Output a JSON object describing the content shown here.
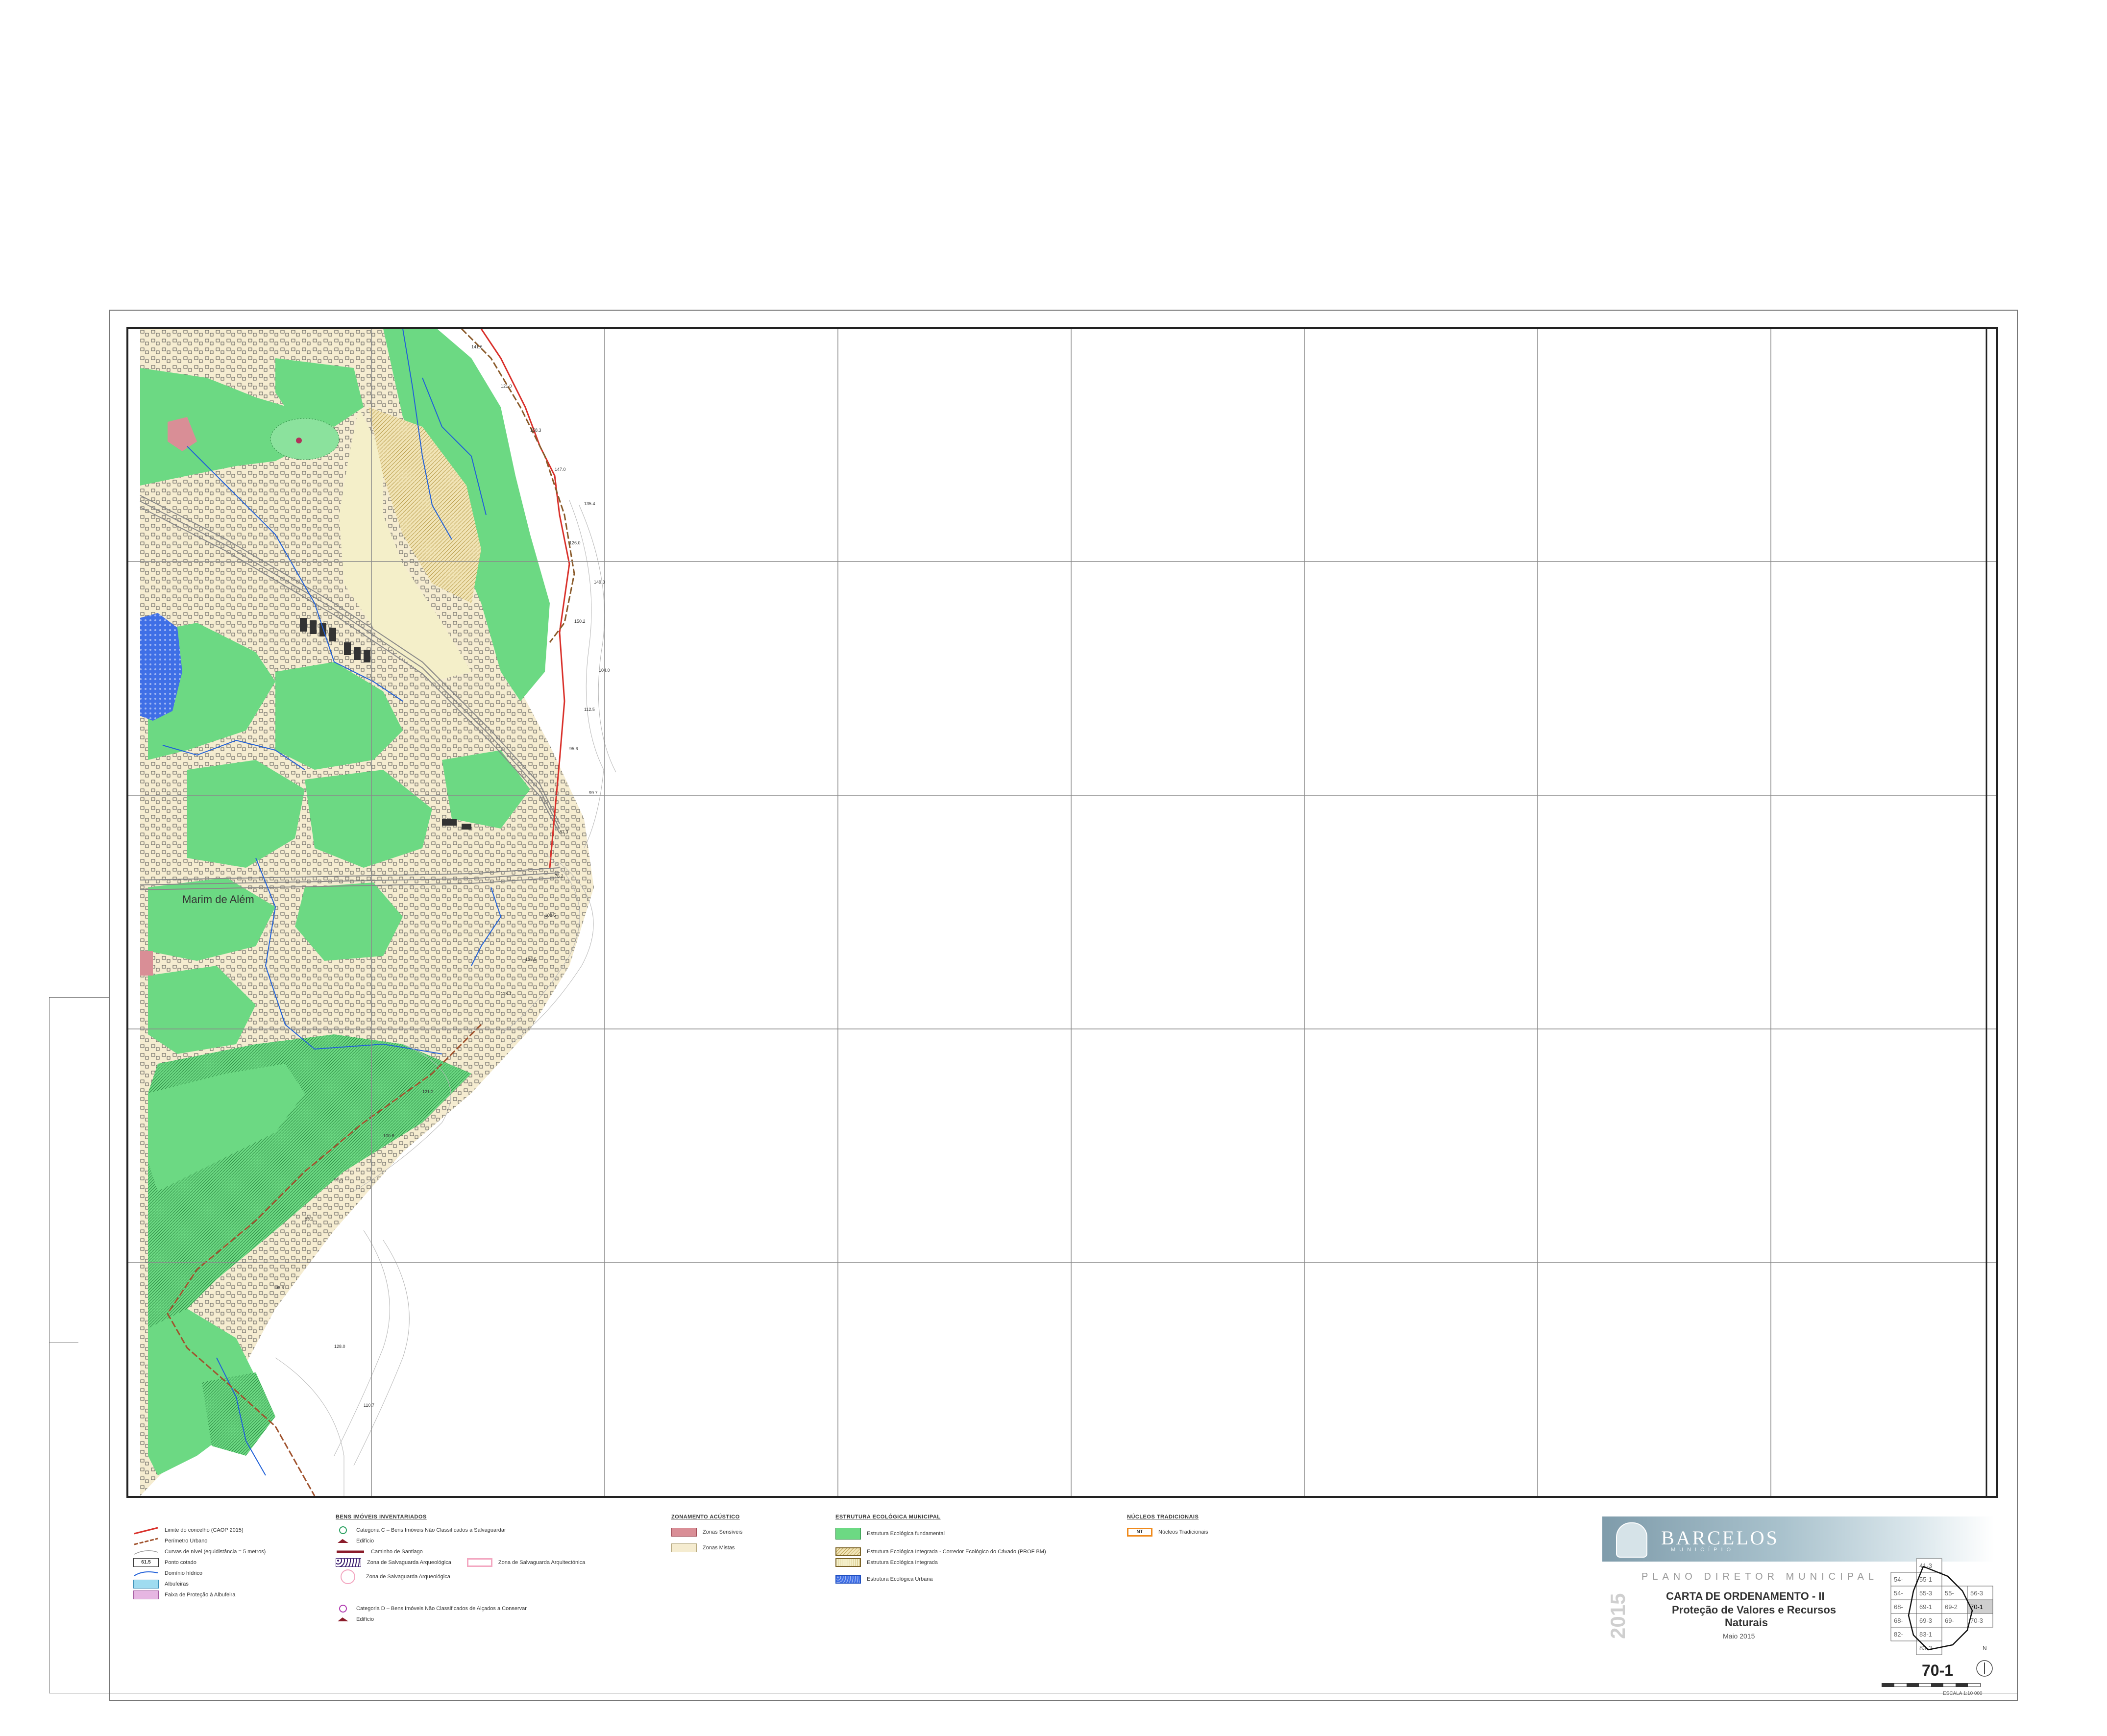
{
  "map": {
    "place_labels": [
      "Marim de Além"
    ],
    "spot_heights": [
      "141.6",
      "121.0",
      "158.3",
      "147.0",
      "135.4",
      "126.0",
      "149.3",
      "150.2",
      "104.0",
      "112.5",
      "95.6",
      "99.7",
      "87.3",
      "76.2",
      "108.5",
      "133.5",
      "118.7",
      "121.2",
      "100.8",
      "91.3",
      "83.3",
      "96.6",
      "128.0",
      "110.7"
    ]
  },
  "legend": {
    "col1": {
      "items": [
        {
          "label": "Limite do concelho (CAOP 2015)",
          "symbol": "red-line"
        },
        {
          "label": "Perímetro Urbano",
          "symbol": "dash-line"
        },
        {
          "label": "Curvas de nível (equidistância = 5 metros)",
          "symbol": "contour-line"
        },
        {
          "label": "Ponto cotado",
          "symbol": "spot-height",
          "value": "61.5"
        },
        {
          "label": "Domínio hídrico",
          "symbol": "blue-line"
        },
        {
          "label": "Albufeiras",
          "symbol": "light-blue"
        },
        {
          "label": "Faixa de Proteção à Albufeira",
          "symbol": "pink"
        }
      ]
    },
    "col2": {
      "title": "BENS IMÓVEIS INVENTARIADOS",
      "items": [
        {
          "label": "Categoria C – Bens Imóveis Não Classificados a Salvaguardar"
        },
        {
          "label": "Edifício"
        },
        {
          "label": "Caminho de Santiago"
        },
        {
          "label": "Zona de Salvaguarda Arqueológica"
        },
        {
          "label": "Zona de Salvaguarda Arquitectónica"
        },
        {
          "label": "Zona de Salvaguarda Arqueológica"
        },
        {
          "label": "Categoria D – Bens Imóveis Não Classificados de Alçados a Conservar"
        },
        {
          "label": "Edifício"
        }
      ]
    },
    "col3": {
      "title": "ZONAMENTO ACÚSTICO",
      "items": [
        {
          "label": "Zonas Sensíveis",
          "color": "#d98e96"
        },
        {
          "label": "Zonas Mistas",
          "color": "#f5ecd0"
        }
      ]
    },
    "col4": {
      "title": "ESTRUTURA ECOLÓGICA MUNICIPAL",
      "items": [
        {
          "label": "Estrutura Ecológica fundamental",
          "color": "#6cd983"
        },
        {
          "label": "Estrutura Ecológica Integrada - Corredor Ecológico do Cávado (PROF BM)",
          "color": "#e9d99a"
        },
        {
          "label": "Estrutura Ecológica Integrada",
          "color": "#f4efc9"
        },
        {
          "label": "Estrutura Ecológica Urbana",
          "color": "#4f7fe0"
        }
      ]
    },
    "col5": {
      "title": "NÚCLEOS TRADICIONAIS",
      "items": [
        {
          "label": "Núcleos Tradicionais",
          "code": "NT",
          "color": "#f08a1c"
        }
      ]
    }
  },
  "title_block": {
    "brand": "BARCELOS",
    "brand_sub": "MUNICÍPIO",
    "plan": "PLANO DIRETOR MUNICIPAL",
    "year": "2015",
    "title_line1": "CARTA DE ORDENAMENTO - II",
    "title_line2": "Proteção de Valores e Recursos",
    "title_line3": "Naturais",
    "date": "Maio 2015",
    "sheet_number": "70-1",
    "scale": "ESCALA 1:10 000",
    "north": "N"
  },
  "index_grid": {
    "rows": [
      [
        "",
        "41-3",
        "",
        ""
      ],
      [
        "54-",
        "55-1",
        "",
        ""
      ],
      [
        "54-",
        "55-3",
        "55-",
        "56-3"
      ],
      [
        "68-",
        "69-1",
        "69-2",
        "70-1"
      ],
      [
        "68-",
        "69-3",
        "69-",
        "70-3"
      ],
      [
        "82-",
        "83-1",
        "",
        ""
      ],
      [
        "",
        "83-3",
        "",
        ""
      ]
    ],
    "current": "70-1"
  },
  "colors": {
    "forest_green": "#6cd983",
    "urban_cream": "#f5ecd0",
    "water_blue": "#3f6fe6",
    "boundary_red": "#d9302a",
    "boundary_brown": "#8a5a2a",
    "frame": "#222222"
  }
}
